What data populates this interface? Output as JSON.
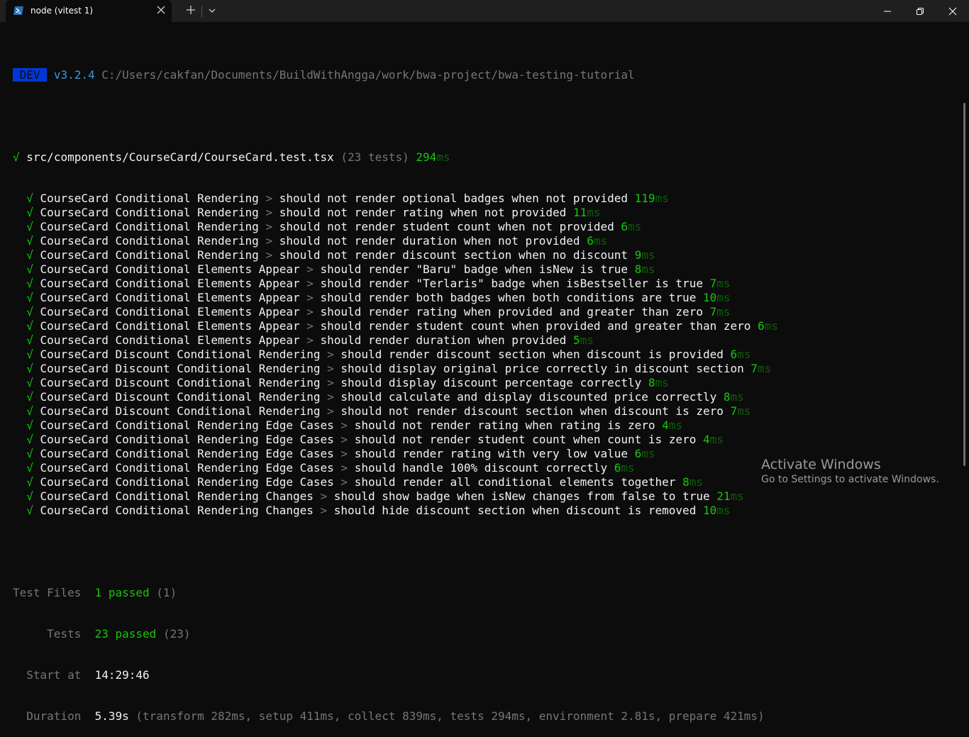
{
  "window": {
    "tab_title": "node (vitest 1)",
    "tab_icon": "powershell-icon"
  },
  "header": {
    "badge": "DEV",
    "version": "v3.2.4",
    "path": "C:/Users/cakfan/Documents/BuildWithAngga/work/bwa-project/bwa-testing-tutorial"
  },
  "file": {
    "check": "√",
    "name": "src/components/CourseCard/CourseCard.test.tsx",
    "count": "(23 tests)",
    "time": "294",
    "unit": "ms"
  },
  "tests": [
    {
      "suite": "CourseCard Conditional Rendering",
      "name": "should not render optional badges when not provided",
      "time": "119"
    },
    {
      "suite": "CourseCard Conditional Rendering",
      "name": "should not render rating when not provided",
      "time": "11"
    },
    {
      "suite": "CourseCard Conditional Rendering",
      "name": "should not render student count when not provided",
      "time": "6"
    },
    {
      "suite": "CourseCard Conditional Rendering",
      "name": "should not render duration when not provided",
      "time": "6"
    },
    {
      "suite": "CourseCard Conditional Rendering",
      "name": "should not render discount section when no discount",
      "time": "9"
    },
    {
      "suite": "CourseCard Conditional Elements Appear",
      "name": "should render \"Baru\" badge when isNew is true",
      "time": "8"
    },
    {
      "suite": "CourseCard Conditional Elements Appear",
      "name": "should render \"Terlaris\" badge when isBestseller is true",
      "time": "7"
    },
    {
      "suite": "CourseCard Conditional Elements Appear",
      "name": "should render both badges when both conditions are true",
      "time": "10"
    },
    {
      "suite": "CourseCard Conditional Elements Appear",
      "name": "should render rating when provided and greater than zero",
      "time": "7"
    },
    {
      "suite": "CourseCard Conditional Elements Appear",
      "name": "should render student count when provided and greater than zero",
      "time": "6"
    },
    {
      "suite": "CourseCard Conditional Elements Appear",
      "name": "should render duration when provided",
      "time": "5"
    },
    {
      "suite": "CourseCard Discount Conditional Rendering",
      "name": "should render discount section when discount is provided",
      "time": "6"
    },
    {
      "suite": "CourseCard Discount Conditional Rendering",
      "name": "should display original price correctly in discount section",
      "time": "7"
    },
    {
      "suite": "CourseCard Discount Conditional Rendering",
      "name": "should display discount percentage correctly",
      "time": "8"
    },
    {
      "suite": "CourseCard Discount Conditional Rendering",
      "name": "should calculate and display discounted price correctly",
      "time": "8"
    },
    {
      "suite": "CourseCard Discount Conditional Rendering",
      "name": "should not render discount section when discount is zero",
      "time": "7"
    },
    {
      "suite": "CourseCard Conditional Rendering Edge Cases",
      "name": "should not render rating when rating is zero",
      "time": "4"
    },
    {
      "suite": "CourseCard Conditional Rendering Edge Cases",
      "name": "should not render student count when count is zero",
      "time": "4"
    },
    {
      "suite": "CourseCard Conditional Rendering Edge Cases",
      "name": "should render rating with very low value",
      "time": "6"
    },
    {
      "suite": "CourseCard Conditional Rendering Edge Cases",
      "name": "should handle 100% discount correctly",
      "time": "6"
    },
    {
      "suite": "CourseCard Conditional Rendering Edge Cases",
      "name": "should render all conditional elements together",
      "time": "8"
    },
    {
      "suite": "CourseCard Conditional Rendering Changes",
      "name": "should show badge when isNew changes from false to true",
      "time": "21"
    },
    {
      "suite": "CourseCard Conditional Rendering Changes",
      "name": "should hide discount section when discount is removed",
      "time": "10"
    }
  ],
  "summary": {
    "files_label": "Test Files",
    "files_passed": "1 passed",
    "files_total": "(1)",
    "tests_label": "Tests",
    "tests_passed": "23 passed",
    "tests_total": "(23)",
    "start_label": "Start at",
    "start_value": "14:29:46",
    "duration_label": "Duration",
    "duration_value": "5.39s",
    "duration_detail": "(transform 282ms, setup 411ms, collect 839ms, tests 294ms, environment 2.81s, prepare 421ms)"
  },
  "watermark": {
    "title": "Activate Windows",
    "subtitle": "Go to Settings to activate Windows."
  }
}
